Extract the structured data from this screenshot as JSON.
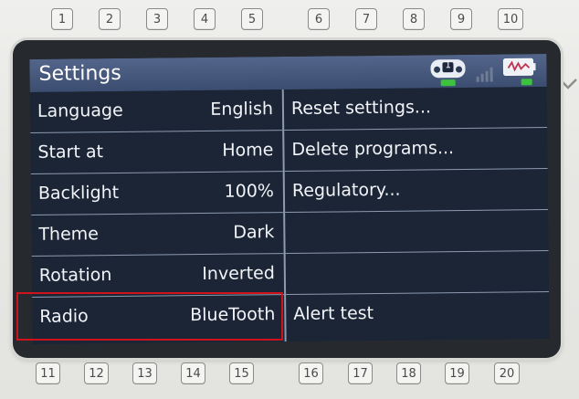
{
  "top_keys": [
    "1",
    "2",
    "3",
    "4",
    "5",
    "6",
    "7",
    "8",
    "9",
    "10"
  ],
  "bottom_keys": [
    "11",
    "12",
    "13",
    "14",
    "15",
    "16",
    "17",
    "18",
    "19",
    "20"
  ],
  "screen": {
    "title": "Settings",
    "status_icons": [
      "controller-icon",
      "signal-bars-icon",
      "battery-icon"
    ],
    "controller_badge": "1"
  },
  "settings_left": [
    {
      "label": "Language",
      "value": "English"
    },
    {
      "label": "Start at",
      "value": "Home"
    },
    {
      "label": "Backlight",
      "value": "100%"
    },
    {
      "label": "Theme",
      "value": "Dark"
    },
    {
      "label": "Rotation",
      "value": "Inverted"
    },
    {
      "label": "Radio",
      "value": "BlueTooth"
    }
  ],
  "settings_right": [
    {
      "label": "Reset settings..."
    },
    {
      "label": "Delete programs..."
    },
    {
      "label": "Regulatory..."
    },
    {
      "label": ""
    },
    {
      "label": ""
    },
    {
      "label": "Alert test"
    }
  ],
  "colors": {
    "titlebar": "#3b4d70",
    "background": "#1b2536",
    "divider": "#8d9bb0",
    "highlight_border": "#d0121c",
    "status_green": "#3cc23c"
  }
}
